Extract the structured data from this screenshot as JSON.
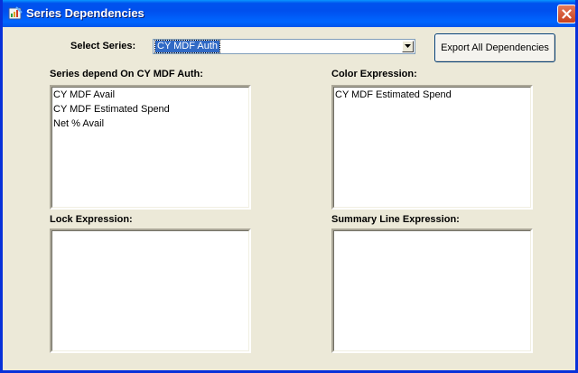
{
  "window": {
    "title": "Series Dependencies"
  },
  "series_select": {
    "label": "Select Series:",
    "selected": "CY MDF Auth"
  },
  "toolbar": {
    "export_label": "Export All Dependencies"
  },
  "depends_panel": {
    "label": "Series depend On CY MDF Auth:",
    "items": [
      "CY MDF Avail",
      "CY MDF Estimated Spend",
      "Net % Avail"
    ]
  },
  "color_panel": {
    "label": "Color Expression:",
    "items": [
      "CY MDF Estimated Spend"
    ]
  },
  "lock_panel": {
    "label": "Lock Expression:",
    "items": []
  },
  "summary_panel": {
    "label": "Summary Line Expression:",
    "items": []
  },
  "colors": {
    "titlebar": "#0054E3",
    "selection": "#316AC5",
    "window_bg": "#ECE9D8",
    "close_button": "#D2542F"
  },
  "icons": {
    "app": "app-icon",
    "close": "close-icon",
    "dropdown": "chevron-down-icon"
  }
}
